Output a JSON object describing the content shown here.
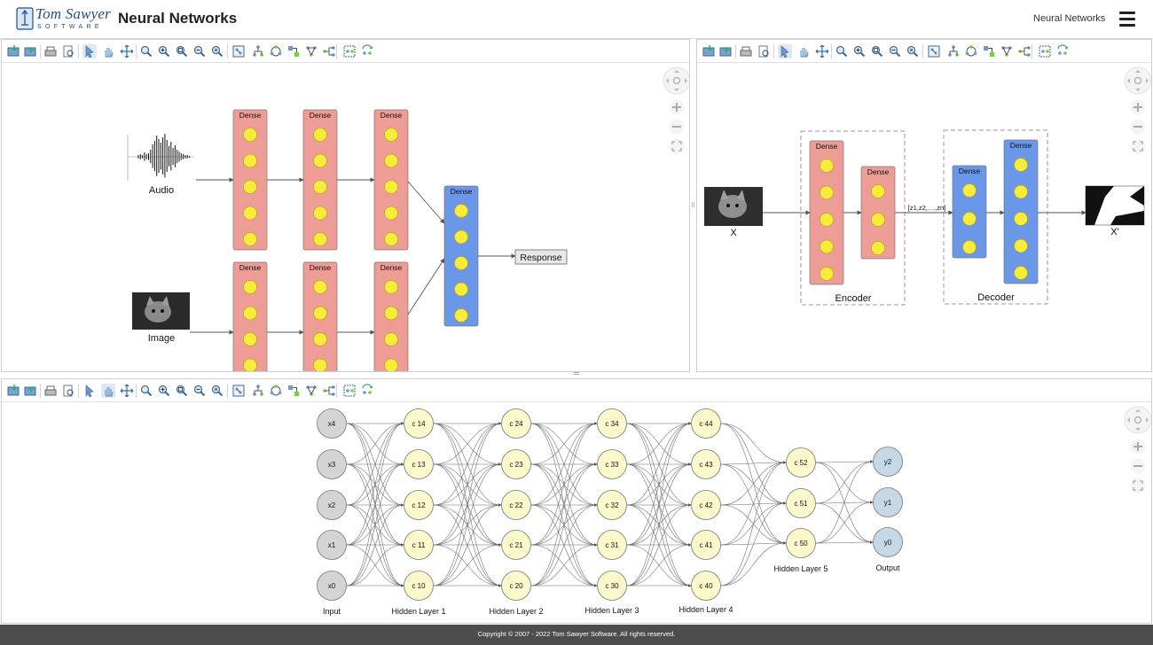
{
  "header": {
    "title": "Neural Networks",
    "logo_primary": "Tom Sawyer",
    "logo_secondary": "SOFTWARE",
    "nav_link": "Neural Networks"
  },
  "toolbar_icons": [
    "open-icon",
    "save-icon",
    "print-icon",
    "print-preview-icon",
    "select-tool-icon",
    "pan-tool-icon",
    "move-icon",
    "zoom-icon",
    "zoom-in-icon",
    "zoom-area-icon",
    "zoom-out-icon",
    "zoom-fit-icon",
    "overview-icon",
    "hierarchical-layout-icon",
    "circular-layout-icon",
    "orthogonal-layout-icon",
    "symmetric-layout-icon",
    "tree-layout-icon",
    "incremental-layout-icon",
    "reset-layout-icon"
  ],
  "panel_a": {
    "inputs": [
      "Audio",
      "Image"
    ],
    "layer_label": "Dense",
    "response": "Response"
  },
  "panel_b": {
    "input": "X",
    "output": "X'",
    "latent": "[z1,z2,....,zn]",
    "encoder": "Encoder",
    "decoder": "Decoder",
    "layer_label": "Dense"
  },
  "panel_c": {
    "inputs": [
      "x4",
      "x3",
      "x2",
      "x1",
      "x0"
    ],
    "hidden1": [
      "c 14",
      "c 13",
      "c 12",
      "c 11",
      "c 10"
    ],
    "hidden2": [
      "c 24",
      "c 23",
      "c 22",
      "c 21",
      "c 20"
    ],
    "hidden3": [
      "c 34",
      "c 33",
      "c 32",
      "c 31",
      "c 30"
    ],
    "hidden4": [
      "c 44",
      "c 43",
      "c 42",
      "c 41",
      "c 40"
    ],
    "hidden5": [
      "c 52",
      "c 51",
      "c 50"
    ],
    "outputs": [
      "y2",
      "y1",
      "y0"
    ],
    "layer_labels": [
      "Input",
      "Hidden Layer 1",
      "Hidden Layer 2",
      "Hidden Layer 3",
      "Hidden Layer 4",
      "Hidden Layer 5",
      "Output"
    ]
  },
  "colors": {
    "dense_red": "#ed9d96",
    "dense_blue": "#6b97e8",
    "neuron_yellow": "#f8ec3a",
    "node_gray": "#d4d4d4",
    "node_cream": "#fbf8cc",
    "node_blue": "#c6d8e6",
    "footer_bg": "#4d4d4d"
  },
  "footer": {
    "copyright": "Copyright © 2007 - 2022 Tom Sawyer Software. All rights reserved."
  }
}
